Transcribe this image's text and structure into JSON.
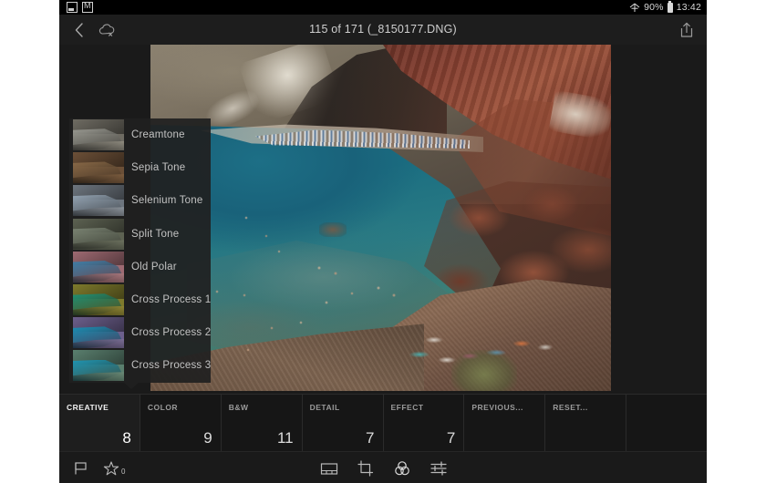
{
  "status_bar": {
    "left_icons": [
      "screenshot-icon",
      "mail-icon"
    ],
    "wifi_icon": "wifi-icon",
    "battery_percent": "90%",
    "battery_icon": "battery-icon",
    "time": "13:42"
  },
  "top_bar": {
    "back_icon": "chevron-left-icon",
    "cloud_icon": "cloud-offline-icon",
    "title": "115 of 171 (_8150177.DNG)",
    "share_icon": "share-icon"
  },
  "photo": {
    "alt": "Red Beach, Santorini — red volcanic cliff above a turquoise cove with swimmers and beach umbrellas"
  },
  "presets": {
    "items": [
      {
        "label": "Creamtone",
        "land": "#6e6b62",
        "sea": "#9a9a92",
        "shore": "#8e8a7e"
      },
      {
        "label": "Sepia Tone",
        "land": "#6b4f37",
        "sea": "#8a6a48",
        "shore": "#7d5d3f"
      },
      {
        "label": "Selenium Tone",
        "land": "#6d757e",
        "sea": "#93a3b2",
        "shore": "#8d949c"
      },
      {
        "label": "Split Tone",
        "land": "#5d6252",
        "sea": "#7b8473",
        "shore": "#6e7360"
      },
      {
        "label": "Old Polar",
        "land": "#9e6a72",
        "sea": "#3f7fa8",
        "shore": "#a8777c"
      },
      {
        "label": "Cross Process 1",
        "land": "#7e7a2c",
        "sea": "#1f8f74",
        "shore": "#8e8434"
      },
      {
        "label": "Cross Process 2",
        "land": "#6c5f8c",
        "sea": "#1b8fb4",
        "shore": "#7a6d94"
      },
      {
        "label": "Cross Process 3",
        "land": "#5a7f6e",
        "sea": "#1f95b2",
        "shore": "#6a8a76"
      }
    ]
  },
  "tabs": [
    {
      "label": "CREATIVE",
      "count": "8",
      "active": true
    },
    {
      "label": "COLOR",
      "count": "9",
      "active": false
    },
    {
      "label": "B&W",
      "count": "11",
      "active": false
    },
    {
      "label": "DETAIL",
      "count": "7",
      "active": false
    },
    {
      "label": "EFFECT",
      "count": "7",
      "active": false
    },
    {
      "label": "PREVIOUS...",
      "count": "",
      "active": false
    },
    {
      "label": "RESET...",
      "count": "",
      "active": false
    },
    {
      "label": "",
      "count": "",
      "active": false
    }
  ],
  "bottom_bar": {
    "flag_icon": "flag-icon",
    "star_icon": "star-rating-icon",
    "star_count": "0",
    "view_icon": "filmstrip-view-icon",
    "crop_icon": "crop-icon",
    "presets_icon": "color-mix-icon",
    "edit_icon": "sliders-icon"
  },
  "colors": {
    "app_background": "#1a1a1a",
    "status_bar": "#000000",
    "panel": "#202020",
    "tab_active": "#1e1e1e",
    "text_primary": "#f2f2f2",
    "text_secondary": "#9a9a9a"
  }
}
